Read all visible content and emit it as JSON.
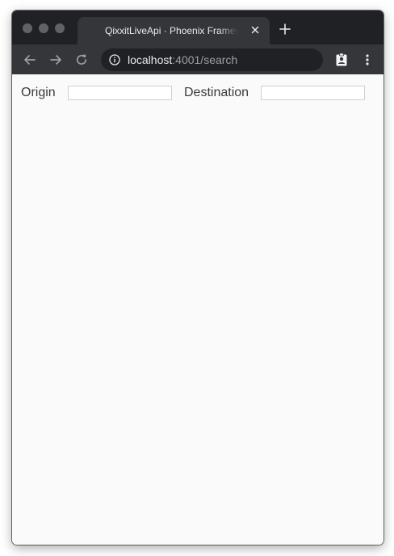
{
  "browser": {
    "tab": {
      "title": "QixxitLiveApi · Phoenix Framework"
    },
    "address_bar": {
      "host": "localhost",
      "path": ":4001/search"
    }
  },
  "search_form": {
    "origin": {
      "label": "Origin",
      "value": "",
      "placeholder": ""
    },
    "destination": {
      "label": "Destination",
      "value": "",
      "placeholder": ""
    }
  },
  "icons": {
    "close_tab": "close-icon",
    "new_tab": "plus-icon",
    "back": "arrow-left-icon",
    "forward": "arrow-right-icon",
    "reload": "reload-icon",
    "site_info": "info-icon",
    "profile": "profile-badge-icon",
    "menu": "kebab-menu-icon"
  },
  "colors": {
    "tabstrip_bg": "#202124",
    "toolbar_bg": "#35363a",
    "page_bg": "#fafafa"
  }
}
